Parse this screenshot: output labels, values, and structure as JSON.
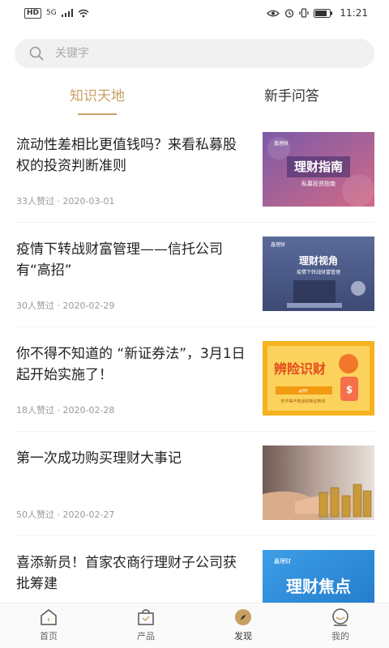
{
  "status_bar": {
    "left_badge": "HD",
    "signal_label": "5G",
    "time": "11:21"
  },
  "search": {
    "placeholder": "关键字"
  },
  "tabs": [
    {
      "label": "知识天地",
      "active": true
    },
    {
      "label": "新手问答",
      "active": false
    }
  ],
  "articles": [
    {
      "title": "流动性差相比更值钱吗？来看私募股权的投资判断准则",
      "meta": "33人赞过 · 2020-03-01",
      "thumb_text_main": "理财指南",
      "thumb_text_sub": "私募投资指南",
      "thumb_text_top": "鑫理财",
      "thumb_colors": [
        "#8a5a9c",
        "#c25a7c"
      ]
    },
    {
      "title": "疫情下转战财富管理——信托公司有“高招”",
      "meta": "30人赞过 · 2020-02-29",
      "thumb_text_main": "理财视角",
      "thumb_text_sub": "疫情下转战财富管理",
      "thumb_text_top": "鑫理财",
      "thumb_colors": [
        "#4b5a86",
        "#6d7fb0"
      ]
    },
    {
      "title": "你不得不知道的 “新证券法”，3月1日起开始实施了！",
      "meta": "18人赞过 · 2020-02-28",
      "thumb_text_main": "辨险识财",
      "thumb_text_sub": "你不得不知道的新证券法",
      "thumb_text_top": "APP",
      "thumb_colors": [
        "#f6b21f",
        "#f7c84a"
      ]
    },
    {
      "title": "第一次成功购买理财大事记",
      "meta": "50人赞过 · 2020-02-27",
      "thumb_text_main": "",
      "thumb_text_sub": "",
      "thumb_text_top": "",
      "thumb_colors": [
        "#c9a07a",
        "#e8d6c4"
      ]
    },
    {
      "title": "喜添新员！首家农商行理财子公司获批筹建",
      "meta": "",
      "thumb_text_main": "理财焦点",
      "thumb_text_sub": "",
      "thumb_text_top": "鑫理财",
      "thumb_colors": [
        "#2a8fd8",
        "#56b2ec"
      ]
    }
  ],
  "bottom_nav": [
    {
      "label": "首页",
      "icon": "home-icon",
      "active": false
    },
    {
      "label": "产品",
      "icon": "bag-icon",
      "active": false
    },
    {
      "label": "发现",
      "icon": "compass-icon",
      "active": true
    },
    {
      "label": "我的",
      "icon": "user-icon",
      "active": false
    }
  ],
  "colors": {
    "accent": "#c8a064",
    "text": "#222222",
    "meta": "#9a9a9a",
    "search_bg": "#f1f1f1"
  }
}
